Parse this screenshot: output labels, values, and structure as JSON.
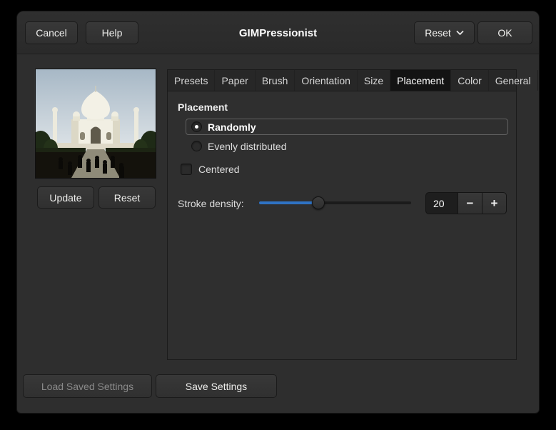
{
  "window": {
    "title": "GIMPressionist"
  },
  "header": {
    "cancel": "Cancel",
    "help": "Help",
    "reset": "Reset",
    "ok": "OK"
  },
  "preview": {
    "update": "Update",
    "reset": "Reset"
  },
  "tabs": [
    {
      "label": "Presets",
      "active": false
    },
    {
      "label": "Paper",
      "active": false
    },
    {
      "label": "Brush",
      "active": false
    },
    {
      "label": "Orientation",
      "active": false
    },
    {
      "label": "Size",
      "active": false
    },
    {
      "label": "Placement",
      "active": true
    },
    {
      "label": "Color",
      "active": false
    },
    {
      "label": "General",
      "active": false
    }
  ],
  "placement": {
    "section_title": "Placement",
    "options": [
      {
        "label": "Randomly",
        "selected": true,
        "focused": true
      },
      {
        "label": "Evenly distributed",
        "selected": false,
        "focused": false
      }
    ],
    "centered": {
      "label": "Centered",
      "checked": false
    },
    "stroke_density": {
      "label": "Stroke density:",
      "value": "20",
      "minus": "−",
      "plus": "+"
    }
  },
  "footer": {
    "load": "Load Saved Settings",
    "load_enabled": false,
    "save": "Save Settings"
  },
  "colors": {
    "accent_blue": "#2f73c4",
    "dialog_bg": "#2e2e2e",
    "active_tab_bg": "#131313",
    "disabled_text": "#8a8a8a"
  }
}
